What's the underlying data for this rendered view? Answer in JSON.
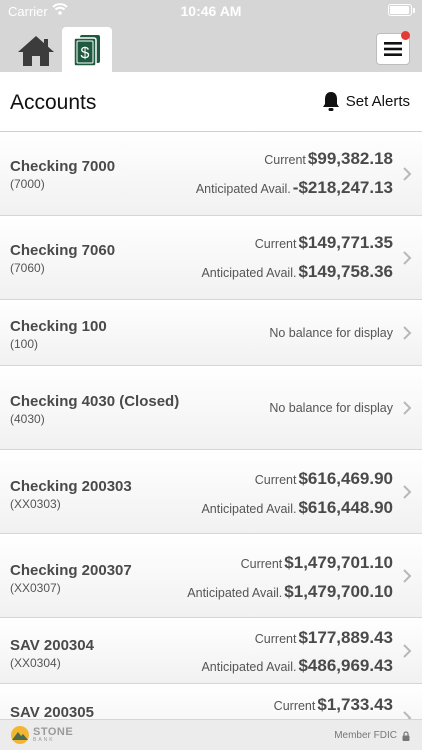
{
  "status_bar": {
    "carrier": "Carrier",
    "time": "10:46 AM"
  },
  "nav": {
    "home_icon": "home-icon",
    "accounts_icon": "money-icon",
    "menu_icon": "hamburger-menu-icon",
    "notification_color": "#e53935"
  },
  "header": {
    "title": "Accounts",
    "set_alerts_label": "Set Alerts"
  },
  "accounts": [
    {
      "name": "Checking 7000",
      "number": "(7000)",
      "current_label": "Current",
      "current": "$99,382.18",
      "anticipated_label": "Anticipated Avail.",
      "anticipated": "-$218,247.13"
    },
    {
      "name": "Checking 7060",
      "number": "(7060)",
      "current_label": "Current",
      "current": "$149,771.35",
      "anticipated_label": "Anticipated Avail.",
      "anticipated": "$149,758.36"
    },
    {
      "name": "Checking 100",
      "number": "(100)",
      "no_balance": "No balance for display"
    },
    {
      "name": "Checking 4030 (Closed)",
      "number": "(4030)",
      "no_balance": "No balance for display"
    },
    {
      "name": "Checking 200303",
      "number": "(XX0303)",
      "current_label": "Current",
      "current": "$616,469.90",
      "anticipated_label": "Anticipated Avail.",
      "anticipated": "$616,448.90"
    },
    {
      "name": "Checking 200307",
      "number": "(XX0307)",
      "current_label": "Current",
      "current": "$1,479,701.10",
      "anticipated_label": "Anticipated Avail.",
      "anticipated": "$1,479,700.10"
    },
    {
      "name": "SAV 200304",
      "number": "(XX0304)",
      "current_label": "Current",
      "current": "$177,889.43",
      "anticipated_label": "Anticipated Avail.",
      "anticipated": "$486,969.43"
    },
    {
      "name": "SAV 200305",
      "number": "",
      "current_label": "Current",
      "current": "$1,733.43"
    }
  ],
  "footer": {
    "brand": "STONE",
    "brand_sub": "BANK",
    "member_fdic": "Member FDIC"
  },
  "colors": {
    "top_bar": "#d6d6d6",
    "accounts_icon_green": "#1f5a40",
    "text_dark": "#4a4a4a"
  }
}
